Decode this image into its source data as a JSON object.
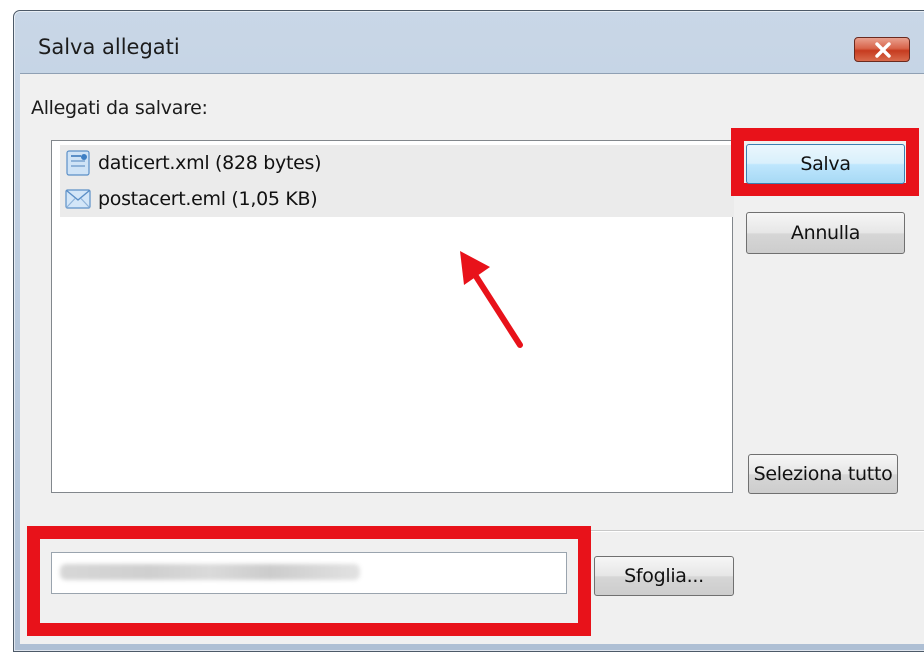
{
  "window": {
    "title": "Salva allegati",
    "close_icon": "close-icon"
  },
  "attachments": {
    "label": "Allegati da salvare:",
    "items": [
      {
        "name": "daticert.xml (828 bytes)",
        "icon": "xml-file-icon"
      },
      {
        "name": "postacert.eml (1,05 KB)",
        "icon": "email-file-icon"
      }
    ]
  },
  "buttons": {
    "save": "Salva",
    "cancel": "Annulla",
    "select_all": "Seleziona tutto",
    "browse": "Sfoglia..."
  },
  "folder": {
    "label": "",
    "path_value": ""
  },
  "annotations": {
    "highlight_color": "#e8121a",
    "arrow_color": "#e8121a"
  }
}
